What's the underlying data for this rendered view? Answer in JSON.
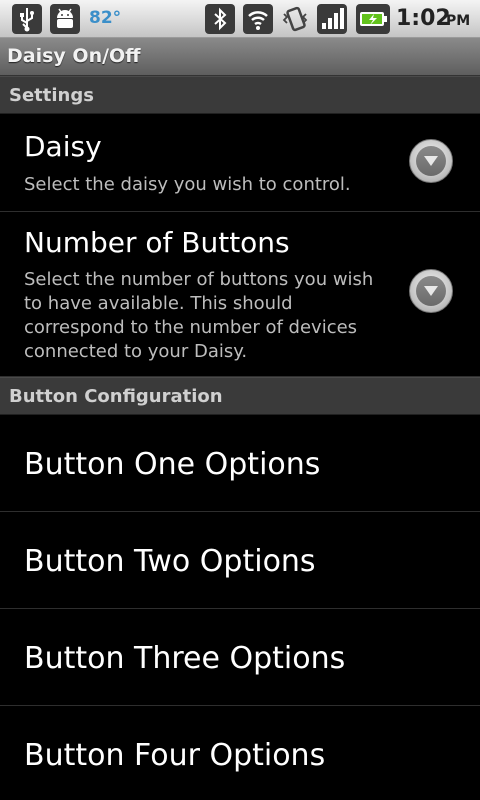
{
  "status_bar": {
    "temperature": "82°",
    "time": "1:02",
    "ampm": "PM",
    "icons": [
      "usb-icon",
      "android-debug-icon",
      "bluetooth-icon",
      "wifi-icon",
      "vibrate-icon",
      "signal-icon",
      "battery-charging-icon"
    ]
  },
  "app": {
    "title": "Daisy On/Off"
  },
  "settings": {
    "header": "Settings",
    "daisy": {
      "title": "Daisy",
      "summary": "Select the daisy you wish to control."
    },
    "num_buttons": {
      "title": "Number of Buttons",
      "summary": "Select the number of buttons you wish to have available. This should correspond to the number of devices connected to your Daisy."
    }
  },
  "button_config": {
    "header": "Button Configuration",
    "items": [
      "Button One Options",
      "Button Two Options",
      "Button Three Options",
      "Button Four Options"
    ]
  }
}
